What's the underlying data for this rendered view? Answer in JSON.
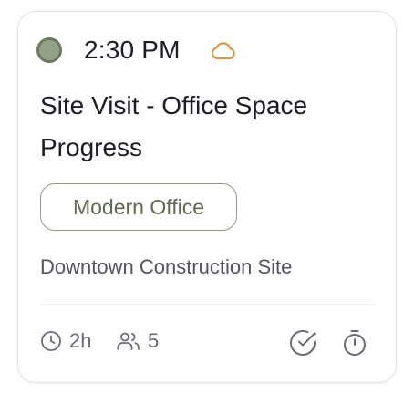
{
  "event": {
    "time": "2:30 PM",
    "weather_icon": "cloud-icon",
    "title": "Site Visit - Office Space Progress",
    "tag": "Modern Office",
    "location": "Downtown Construction Site",
    "duration": "2h",
    "attendees": "5"
  },
  "icons": {
    "duration": "clock-icon",
    "attendees": "users-icon",
    "complete": "check-circle-icon",
    "timer": "timer-icon"
  },
  "colors": {
    "status_dot": "#92a286",
    "status_ring": "#6b7a5f",
    "weather": "#d29a4a",
    "tag_text": "#5e6b52",
    "tag_border": "#8e9c82",
    "text_primary": "#1c1c24",
    "text_muted": "#6a6a74"
  }
}
